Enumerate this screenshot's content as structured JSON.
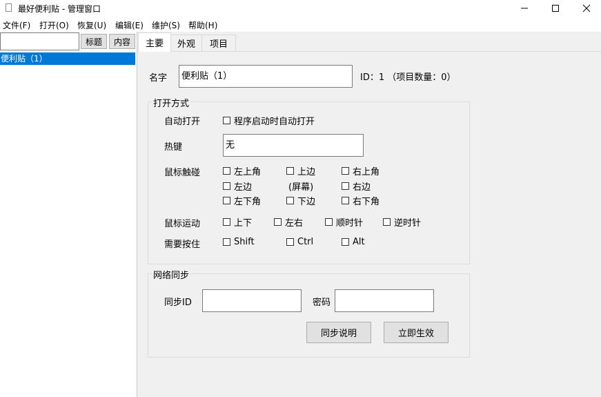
{
  "window": {
    "title": "最好便利贴 - 管理窗口",
    "controls": {
      "minimize": "—",
      "maximize": "☐",
      "close": "✕"
    }
  },
  "menu": [
    "文件(F)",
    "打开(O)",
    "恢复(U)",
    "编辑(E)",
    "维护(S)",
    "帮助(H)"
  ],
  "left": {
    "search_value": "",
    "btn_title": "标题",
    "btn_content": "内容",
    "items": [
      "便利贴（1）"
    ]
  },
  "tabs": [
    "主要",
    "外观",
    "项目"
  ],
  "main": {
    "name_label": "名字",
    "name_value": "便利贴（1）",
    "id_info": "ID：1 （项目数量：0）",
    "open_group": {
      "title": "打开方式",
      "auto_open_label": "自动打开",
      "auto_open_option": "程序启动时自动打开",
      "hotkey_label": "热键",
      "hotkey_value": "无",
      "mouse_touch_label": "鼠标触碰",
      "corners": {
        "top_left": "左上角",
        "top": "上边",
        "top_right": "右上角",
        "left": "左边",
        "screen": "(屏幕)",
        "right": "右边",
        "bottom_left": "左下角",
        "bottom": "下边",
        "bottom_right": "右下角"
      },
      "mouse_move_label": "鼠标运动",
      "moves": [
        "上下",
        "左右",
        "顺时针",
        "逆时针"
      ],
      "hold_label": "需要按住",
      "keys": [
        "Shift",
        "Ctrl",
        "Alt"
      ]
    },
    "sync_group": {
      "title": "网络同步",
      "sync_id_label": "同步ID",
      "sync_id_value": "",
      "password_label": "密码",
      "password_value": "",
      "help_button": "同步说明",
      "apply_button": "立即生效"
    }
  }
}
